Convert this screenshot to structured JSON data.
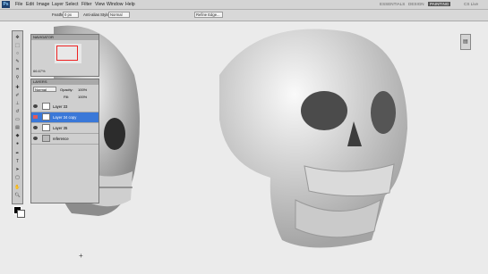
{
  "menu": {
    "logo": "Ps",
    "items": [
      "File",
      "Edit",
      "Image",
      "Layer",
      "Select",
      "Filter",
      "View",
      "Window",
      "Help"
    ],
    "workspace": [
      "ESSENTIALS",
      "DESIGN",
      "PAINTING"
    ],
    "cslive": "CS Live"
  },
  "options": {
    "feather_label": "Feather:",
    "feather_value": "0 px",
    "antialias": "Anti-alias",
    "style_label": "Style:",
    "style_value": "Normal",
    "refine": "Refine Edge..."
  },
  "navigator": {
    "title": "NAVIGATOR",
    "zoom": "66.67%"
  },
  "layers": {
    "title": "LAYERS",
    "blend": "Normal",
    "opacity_label": "Opacity:",
    "opacity": "100%",
    "fill_label": "Fill:",
    "fill": "100%",
    "rows": [
      {
        "name": "Layer 33"
      },
      {
        "name": "Layer 34 copy"
      },
      {
        "name": "Layer 35"
      },
      {
        "name": "reference"
      }
    ]
  },
  "colors": {
    "menubar": "#d4d4d4",
    "panel": "#cfcfcf",
    "selected": "#3a78d8"
  }
}
